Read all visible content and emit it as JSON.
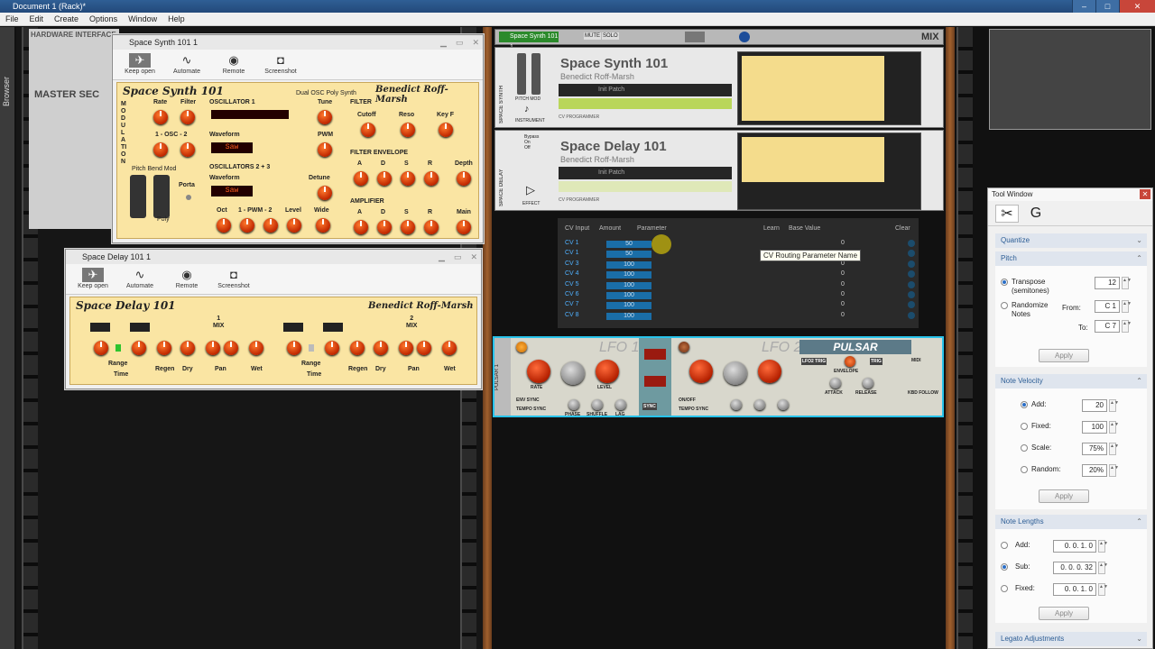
{
  "app": {
    "title": "Document 1 (Rack)*",
    "menu": [
      "File",
      "Edit",
      "Create",
      "Options",
      "Window",
      "Help"
    ],
    "browser_label": "Browser"
  },
  "left_rack": {
    "hardware_interface": "HARDWARE INTERFACE",
    "master_section": "MASTER SEC"
  },
  "synth_window": {
    "title": "Space Synth 101 1",
    "toolbar": [
      "Keep open",
      "Automate",
      "Remote",
      "Screenshot"
    ],
    "panel_title": "Space Synth 101",
    "subtitle": "Dual OSC Poly Synth",
    "author": "Benedict Roff-Marsh",
    "modulation": "MODULATION",
    "mod_rate": "Rate",
    "mod_filter": "Filter",
    "mod_osc": "1 - OSC - 2",
    "pitch_bend": "Pitch Bend Mod",
    "porta": "Porta",
    "poly": "Poly",
    "oscillator1": "OSCILLATOR 1",
    "tune": "Tune",
    "waveform": "Waveform",
    "pwm": "PWM",
    "saw": "Saw",
    "oscillators23": "OSCILLATORS 2 + 3",
    "detune": "Detune",
    "oct": "Oct",
    "pwm2": "1 - PWM - 2",
    "level": "Level",
    "wide": "Wide",
    "filter": "FILTER",
    "cutoff": "Cutoff",
    "reso": "Reso",
    "keyf": "Key F",
    "filter_env": "FILTER ENVELOPE",
    "env_a": "A",
    "env_d": "D",
    "env_s": "S",
    "env_r": "R",
    "depth": "Depth",
    "amplifier": "AMPLIFIER",
    "main": "Main"
  },
  "delay_window": {
    "title": "Space Delay 101 1",
    "toolbar": [
      "Keep open",
      "Automate",
      "Remote",
      "Screenshot"
    ],
    "panel_title": "Space Delay 101",
    "author": "Benedict Roff-Marsh",
    "mix1": "1\nMIX",
    "mix2": "2\nMIX",
    "range": "Range",
    "time": "Time",
    "regen": "Regen",
    "dry": "Dry",
    "pan": "Pan",
    "wet": "Wet"
  },
  "main_rack": {
    "transport_name": "Space Synth 101 1",
    "mute": "MUTE",
    "solo": "SOLO",
    "mix": "MIX",
    "synth": {
      "name": "Space Synth 101",
      "author": "Benedict Roff-Marsh",
      "patch": "Init Patch",
      "cv": "CV PROGRAMMER",
      "side_label": "SPACE SYNTH",
      "instrument": "INSTRUMENT",
      "pitch_mod": "PITCH  MOD"
    },
    "delay": {
      "name": "Space Delay 101",
      "author": "Benedict Roff-Marsh",
      "patch": "Init Patch",
      "cv": "CV PROGRAMMER",
      "side_label": "SPACE DELAY",
      "effect": "EFFECT",
      "bypass": "Bypass\nOn\nOff"
    },
    "cv_programmer": {
      "headers": [
        "CV Input",
        "Amount",
        "Parameter",
        "Learn",
        "Base Value",
        "Clear"
      ],
      "rows": [
        {
          "name": "CV 1",
          "amount": "50",
          "base": "0"
        },
        {
          "name": "CV 1",
          "amount": "50",
          "base": "0"
        },
        {
          "name": "CV 3",
          "amount": "100",
          "base": "0"
        },
        {
          "name": "CV 4",
          "amount": "100",
          "base": "0"
        },
        {
          "name": "CV 5",
          "amount": "100",
          "base": "0"
        },
        {
          "name": "CV 6",
          "amount": "100",
          "base": "0"
        },
        {
          "name": "CV 7",
          "amount": "100",
          "base": "0"
        },
        {
          "name": "CV 8",
          "amount": "100",
          "base": "0"
        }
      ],
      "tooltip": "CV Routing Parameter Name"
    },
    "pulsar": {
      "lfo1": "LFO 1",
      "lfo2": "LFO 2",
      "logo": "PULSAR",
      "rate": "RATE",
      "level": "LEVEL",
      "phase": "PHASE",
      "shuffle": "SHUFFLE",
      "lag": "LAG",
      "env_sync": "ENV SYNC",
      "tempo_sync": "TEMPO SYNC",
      "on_off": "ON/OFF",
      "sync": "SYNC",
      "lfo2_trig": "LFO2 TRIG",
      "trig": "TRIG",
      "envelope": "ENVELOPE",
      "attack": "ATTACK",
      "release": "RELEASE",
      "kbd_follow": "KBD FOLLOW",
      "midi": "MIDI",
      "side": "PULSAR 1"
    }
  },
  "tool_window": {
    "title": "Tool Window",
    "sections": {
      "quantize": "Quantize",
      "pitch": "Pitch",
      "note_velocity": "Note Velocity",
      "note_lengths": "Note Lengths",
      "legato": "Legato Adjustments"
    },
    "pitch": {
      "transpose": "Transpose\n(semitones)",
      "transpose_value": "12",
      "randomize": "Randomize\nNotes",
      "from": "From:",
      "from_value": "C 1",
      "to": "To:",
      "to_value": "C 7",
      "apply": "Apply"
    },
    "velocity": {
      "add": "Add:",
      "add_value": "20",
      "fixed": "Fixed:",
      "fixed_value": "100",
      "scale": "Scale:",
      "scale_value": "75%",
      "random": "Random:",
      "random_value": "20%",
      "apply": "Apply"
    },
    "lengths": {
      "add": "Add:",
      "add_value": "0. 0. 1.  0",
      "sub": "Sub:",
      "sub_value": "0. 0. 0. 32",
      "fixed": "Fixed:",
      "fixed_value": "0. 0. 1.  0",
      "apply": "Apply"
    }
  }
}
